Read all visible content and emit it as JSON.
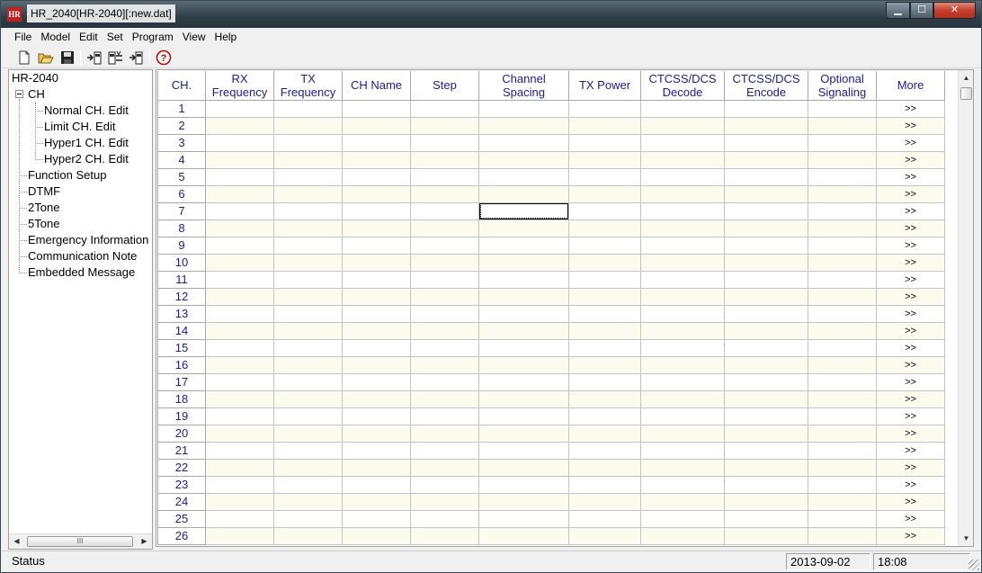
{
  "window": {
    "icon_text": "HR",
    "title": "HR_2040[HR-2040][:new.dat]",
    "min_glyph": "▁",
    "max_glyph": "☐",
    "close_glyph": "✕"
  },
  "menu": [
    "File",
    "Model",
    "Edit",
    "Set",
    "Program",
    "View",
    "Help"
  ],
  "toolbar_icons": [
    "new-file-icon",
    "open-folder-icon",
    "save-disk-icon",
    "read-from-radio-icon",
    "write-to-radio-icon",
    "radio-info-icon",
    "help-icon"
  ],
  "tree": {
    "root": "HR-2040",
    "ch": "CH",
    "ch_children": [
      "Normal CH. Edit",
      "Limit CH. Edit",
      "Hyper1 CH. Edit",
      "Hyper2 CH. Edit"
    ],
    "items": [
      "Function Setup",
      "DTMF",
      "2Tone",
      "5Tone",
      "Emergency Information",
      "Communication Note",
      "Embedded Message"
    ],
    "scroll_left": "◀",
    "scroll_right": "▶",
    "scroll_thumb": "III"
  },
  "grid": {
    "headers": [
      "CH.",
      "RX Frequency",
      "TX Frequency",
      "CH Name",
      "Step",
      "Channel Spacing",
      "TX Power",
      "CTCSS/DCS Decode",
      "CTCSS/DCS Encode",
      "Optional Signaling",
      "More"
    ],
    "channels": [
      "1",
      "2",
      "3",
      "4",
      "5",
      "6",
      "7",
      "8",
      "9",
      "10",
      "11",
      "12",
      "13",
      "14",
      "15",
      "16",
      "17",
      "18",
      "19",
      "20",
      "21",
      "22",
      "23",
      "24",
      "25",
      "26"
    ],
    "more_label": ">>",
    "selected_channel": "7",
    "selected_column": "Channel Spacing",
    "scroll_up": "▲",
    "scroll_down": "▼"
  },
  "status": {
    "text": "Status",
    "date": "2013-09-02",
    "time": "18:08"
  }
}
